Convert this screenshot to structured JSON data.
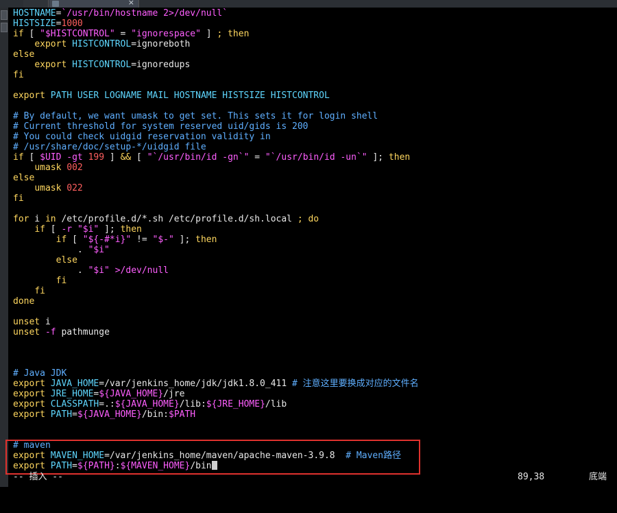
{
  "window": {
    "tab_label": "",
    "tab_close_glyph": "×"
  },
  "editor": {
    "lines": [
      [
        [
          "v",
          "HOSTNAME"
        ],
        [
          "t",
          "="
        ],
        [
          "s",
          "`/usr/bin/hostname 2>/dev/null`"
        ]
      ],
      [
        [
          "v",
          "HISTSIZE"
        ],
        [
          "t",
          "="
        ],
        [
          "n",
          "1000"
        ]
      ],
      [
        [
          "k",
          "if"
        ],
        [
          "t",
          " [ "
        ],
        [
          "s",
          "\"$HISTCONTROL\""
        ],
        [
          "t",
          " = "
        ],
        [
          "s",
          "\"ignorespace\""
        ],
        [
          "t",
          " ] "
        ],
        [
          "k",
          "; then"
        ]
      ],
      [
        [
          "t",
          "    "
        ],
        [
          "k",
          "export"
        ],
        [
          "t",
          " "
        ],
        [
          "v",
          "HISTCONTROL"
        ],
        [
          "t",
          "=ignoreboth"
        ]
      ],
      [
        [
          "k",
          "else"
        ]
      ],
      [
        [
          "t",
          "    "
        ],
        [
          "k",
          "export"
        ],
        [
          "t",
          " "
        ],
        [
          "v",
          "HISTCONTROL"
        ],
        [
          "t",
          "=ignoredups"
        ]
      ],
      [
        [
          "k",
          "fi"
        ]
      ],
      [],
      [
        [
          "k",
          "export"
        ],
        [
          "t",
          " "
        ],
        [
          "v",
          "PATH USER LOGNAME MAIL HOSTNAME HISTSIZE HISTCONTROL"
        ]
      ],
      [],
      [
        [
          "c",
          "# By default, we want umask to get set. This sets it for login shell"
        ]
      ],
      [
        [
          "c",
          "# Current threshold for system reserved uid/gids is 200"
        ]
      ],
      [
        [
          "c",
          "# You could check uidgid reservation validity in"
        ]
      ],
      [
        [
          "c",
          "# /usr/share/doc/setup-*/uidgid file"
        ]
      ],
      [
        [
          "k",
          "if"
        ],
        [
          "t",
          " [ "
        ],
        [
          "s",
          "$UID"
        ],
        [
          "t",
          " "
        ],
        [
          "s",
          "-gt"
        ],
        [
          "t",
          " "
        ],
        [
          "n",
          "199"
        ],
        [
          "t",
          " ] "
        ],
        [
          "k",
          "&&"
        ],
        [
          "t",
          " [ "
        ],
        [
          "s",
          "\"`/usr/bin/id -gn`\""
        ],
        [
          "t",
          " = "
        ],
        [
          "s",
          "\"`/usr/bin/id -un`\""
        ],
        [
          "t",
          " ]; "
        ],
        [
          "k",
          "then"
        ]
      ],
      [
        [
          "t",
          "    "
        ],
        [
          "k",
          "umask"
        ],
        [
          "t",
          " "
        ],
        [
          "n",
          "002"
        ]
      ],
      [
        [
          "k",
          "else"
        ]
      ],
      [
        [
          "t",
          "    "
        ],
        [
          "k",
          "umask"
        ],
        [
          "t",
          " "
        ],
        [
          "n",
          "022"
        ]
      ],
      [
        [
          "k",
          "fi"
        ]
      ],
      [],
      [
        [
          "k",
          "for"
        ],
        [
          "t",
          " i "
        ],
        [
          "k",
          "in"
        ],
        [
          "t",
          " /etc/profile.d/*.sh /etc/profile.d/sh.local "
        ],
        [
          "k",
          "; do"
        ]
      ],
      [
        [
          "t",
          "    "
        ],
        [
          "k",
          "if"
        ],
        [
          "t",
          " [ "
        ],
        [
          "s",
          "-r"
        ],
        [
          "t",
          " "
        ],
        [
          "s",
          "\"$i\""
        ],
        [
          "t",
          " ]; "
        ],
        [
          "k",
          "then"
        ]
      ],
      [
        [
          "t",
          "        "
        ],
        [
          "k",
          "if"
        ],
        [
          "t",
          " [ "
        ],
        [
          "s",
          "\"${-#*i}\""
        ],
        [
          "t",
          " != "
        ],
        [
          "s",
          "\"$-\""
        ],
        [
          "t",
          " ]; "
        ],
        [
          "k",
          "then"
        ]
      ],
      [
        [
          "t",
          "            . "
        ],
        [
          "s",
          "\"$i\""
        ]
      ],
      [
        [
          "t",
          "        "
        ],
        [
          "k",
          "else"
        ]
      ],
      [
        [
          "t",
          "            . "
        ],
        [
          "s",
          "\"$i\""
        ],
        [
          "t",
          " "
        ],
        [
          "s",
          ">/dev/null"
        ]
      ],
      [
        [
          "t",
          "        "
        ],
        [
          "k",
          "fi"
        ]
      ],
      [
        [
          "t",
          "    "
        ],
        [
          "k",
          "fi"
        ]
      ],
      [
        [
          "k",
          "done"
        ]
      ],
      [],
      [
        [
          "k",
          "unset"
        ],
        [
          "t",
          " i"
        ]
      ],
      [
        [
          "k",
          "unset"
        ],
        [
          "t",
          " "
        ],
        [
          "s",
          "-f"
        ],
        [
          "t",
          " pathmunge"
        ]
      ],
      [],
      [],
      [],
      [
        [
          "c",
          "# Java JDK"
        ]
      ],
      [
        [
          "k",
          "export"
        ],
        [
          "t",
          " "
        ],
        [
          "v",
          "JAVA_HOME"
        ],
        [
          "t",
          "=/var/jenkins_home/jdk/jdk1.8.0_411 "
        ],
        [
          "c",
          "# 注意这里要换成对应的文件名"
        ]
      ],
      [
        [
          "k",
          "export"
        ],
        [
          "t",
          " "
        ],
        [
          "v",
          "JRE_HOME"
        ],
        [
          "t",
          "="
        ],
        [
          "s",
          "${JAVA_HOME}"
        ],
        [
          "t",
          "/jre"
        ]
      ],
      [
        [
          "k",
          "export"
        ],
        [
          "t",
          " "
        ],
        [
          "v",
          "CLASSPATH"
        ],
        [
          "t",
          "=.:"
        ],
        [
          "s",
          "${JAVA_HOME}"
        ],
        [
          "t",
          "/lib:"
        ],
        [
          "s",
          "${JRE_HOME}"
        ],
        [
          "t",
          "/lib"
        ]
      ],
      [
        [
          "k",
          "export"
        ],
        [
          "t",
          " "
        ],
        [
          "v",
          "PATH"
        ],
        [
          "t",
          "="
        ],
        [
          "s",
          "${JAVA_HOME}"
        ],
        [
          "t",
          "/bin:"
        ],
        [
          "s",
          "$PATH"
        ]
      ],
      [],
      [],
      [
        [
          "c",
          "# maven"
        ]
      ],
      [
        [
          "k",
          "export"
        ],
        [
          "t",
          " "
        ],
        [
          "v",
          "MAVEN_HOME"
        ],
        [
          "t",
          "=/var/jenkins_home/maven/apache-maven-3.9.8  "
        ],
        [
          "c",
          "# Maven路径"
        ]
      ],
      [
        [
          "k",
          "export"
        ],
        [
          "t",
          " "
        ],
        [
          "v",
          "PATH"
        ],
        [
          "t",
          "="
        ],
        [
          "s",
          "${PATH}"
        ],
        [
          "t",
          ":"
        ],
        [
          "s",
          "${MAVEN_HOME}"
        ],
        [
          "t",
          "/bin"
        ],
        [
          "cursor",
          ""
        ]
      ]
    ]
  },
  "status": {
    "mode": "-- 插入 --",
    "position": "89,38",
    "location": "底端"
  },
  "colors": {
    "background": "#000000",
    "variable": "#5fd7ff",
    "keyword": "#ffd75f",
    "string": "#ff5fff",
    "number": "#ff5f5f",
    "comment": "#5fafff",
    "highlight_box": "#e0322e"
  }
}
